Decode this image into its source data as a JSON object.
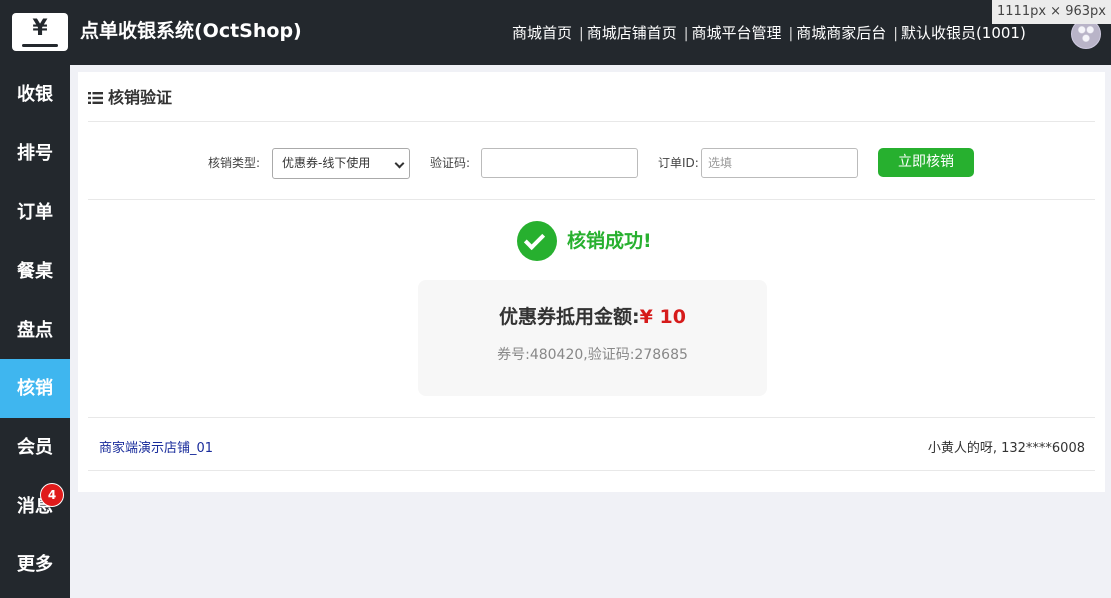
{
  "header": {
    "logo_glyph": "¥",
    "app_title": "点单收银系统(OctShop)",
    "nav_links": [
      "商城首页",
      "商城店铺首页",
      "商城平台管理",
      "商城商家后台",
      "默认收银员(1001)"
    ],
    "nav_separator": "|"
  },
  "size_tag": "1111px × 963px",
  "sidebar": {
    "items": [
      "收银",
      "排号",
      "订单",
      "餐桌",
      "盘点",
      "核销",
      "会员",
      "消息",
      "更多"
    ],
    "active_index": 5,
    "message_badge": "4"
  },
  "panel": {
    "title": "核销验证",
    "form": {
      "type_label": "核销类型:",
      "type_value": "优惠券-线下使用",
      "code_label": "验证码:",
      "code_value": "",
      "order_label": "订单ID:",
      "order_placeholder": "选填",
      "submit_label": "立即核销"
    },
    "result": {
      "success_text": "核销成功!",
      "amount_label": "优惠券抵用金额:",
      "amount_value": "¥ 10",
      "info_text": "券号:480420,验证码:278685"
    },
    "footer": {
      "store_name": "商家端演示店铺_01",
      "customer": "小黄人的呀, 132****6008"
    }
  },
  "colors": {
    "dark_bg": "#23282d",
    "active_blue": "#3fb6ef",
    "success_green": "#27b02f",
    "amount_red": "#d61b1b",
    "link_blue": "#1a2d9c"
  }
}
